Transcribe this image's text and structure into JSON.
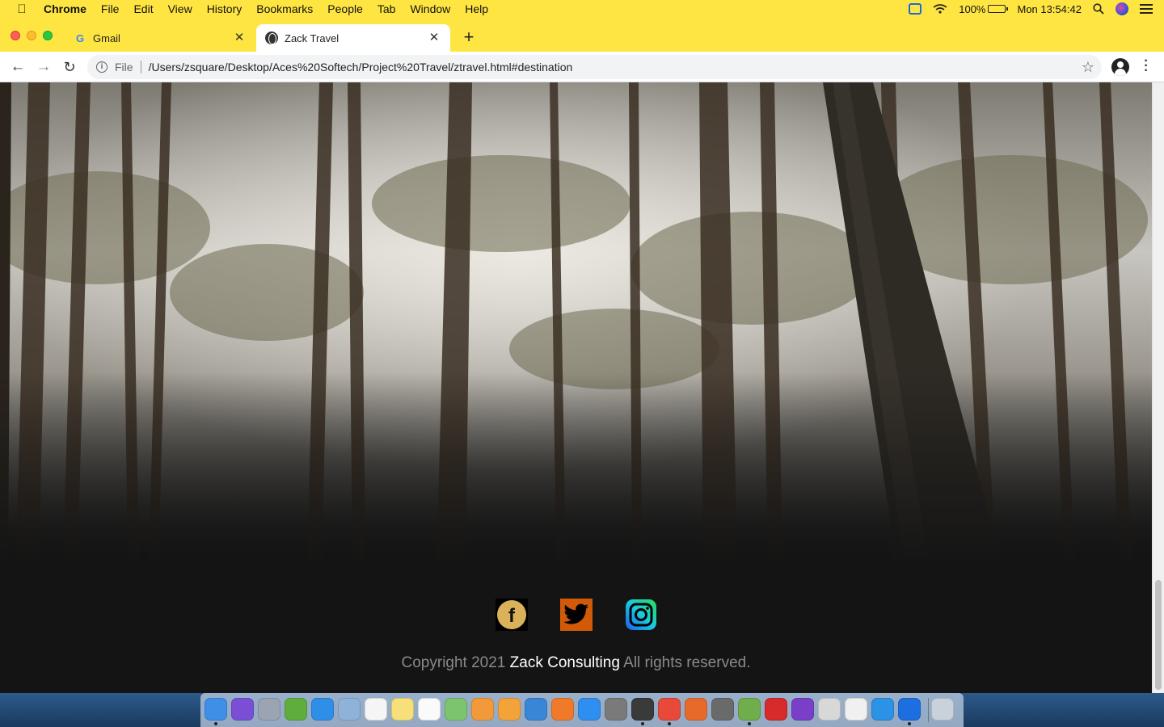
{
  "menubar": {
    "app_name": "Chrome",
    "items": [
      "File",
      "Edit",
      "View",
      "History",
      "Bookmarks",
      "People",
      "Tab",
      "Window",
      "Help"
    ],
    "battery": "100%",
    "clock": "Mon 13:54:42"
  },
  "tabs": [
    {
      "title": "Gmail",
      "icon": "gmail-icon",
      "active": false
    },
    {
      "title": "Zack Travel",
      "icon": "globe-icon",
      "active": true
    }
  ],
  "toolbar": {
    "scheme": "File",
    "url": "/Users/zsquare/Desktop/Aces%20Softech/Project%20Travel/ztravel.html#destination"
  },
  "footer": {
    "social": [
      {
        "name": "facebook",
        "icon": "facebook-icon"
      },
      {
        "name": "twitter",
        "icon": "twitter-icon"
      },
      {
        "name": "instagram",
        "icon": "instagram-icon"
      }
    ],
    "copyright_prefix": "Copyright 2021",
    "brand": "Zack Consulting",
    "copyright_suffix": "All rights reserved."
  },
  "dock": {
    "apps": [
      {
        "icon": "finder-icon",
        "color": "#3f8fe8",
        "running": true
      },
      {
        "icon": "siri-icon",
        "color": "#7a4fd6",
        "running": false
      },
      {
        "icon": "launchpad-icon",
        "color": "#9aa4b3",
        "running": false
      },
      {
        "icon": "chart-icon",
        "color": "#5fae3d",
        "running": false
      },
      {
        "icon": "safari-icon",
        "color": "#2f8fe8",
        "running": false
      },
      {
        "icon": "preview-icon",
        "color": "#8fb2d8",
        "running": false
      },
      {
        "icon": "calendar-icon",
        "color": "#f5f5f5",
        "running": false
      },
      {
        "icon": "notes-icon",
        "color": "#f7e07a",
        "running": false
      },
      {
        "icon": "reminders-icon",
        "color": "#fafafa",
        "running": false
      },
      {
        "icon": "maps-icon",
        "color": "#7cc56d",
        "running": false
      },
      {
        "icon": "photos-icon",
        "color": "#f29a3a",
        "running": false
      },
      {
        "icon": "pages-icon",
        "color": "#f3a33a",
        "running": false
      },
      {
        "icon": "keynote-icon",
        "color": "#3a86d6",
        "running": false
      },
      {
        "icon": "books-icon",
        "color": "#f07a2a",
        "running": false
      },
      {
        "icon": "app-store-icon",
        "color": "#2e8ff0",
        "running": false
      },
      {
        "icon": "system-preferences-icon",
        "color": "#7a7a7a",
        "running": false
      },
      {
        "icon": "sublime-text-icon",
        "color": "#3a3a3a",
        "running": true
      },
      {
        "icon": "chrome-icon",
        "color": "#e8493a",
        "running": true
      },
      {
        "icon": "feather-icon",
        "color": "#e86a2a",
        "running": false
      },
      {
        "icon": "film-icon",
        "color": "#6a6a6a",
        "running": false
      },
      {
        "icon": "android-studio-icon",
        "color": "#6fae4a",
        "running": true
      },
      {
        "icon": "acrobat-icon",
        "color": "#d72a2a",
        "running": false
      },
      {
        "icon": "github-desktop-icon",
        "color": "#7a3fc8",
        "running": false
      },
      {
        "icon": "archive-icon",
        "color": "#d8d8d8",
        "running": false
      },
      {
        "icon": "script-editor-icon",
        "color": "#f0f0f0",
        "running": false
      },
      {
        "icon": "docker-icon",
        "color": "#2b92e6",
        "running": false
      },
      {
        "icon": "teamviewer-icon",
        "color": "#1d6ee0",
        "running": true
      },
      {
        "icon": "trash-icon",
        "color": "#c9d1da",
        "running": false
      }
    ]
  }
}
